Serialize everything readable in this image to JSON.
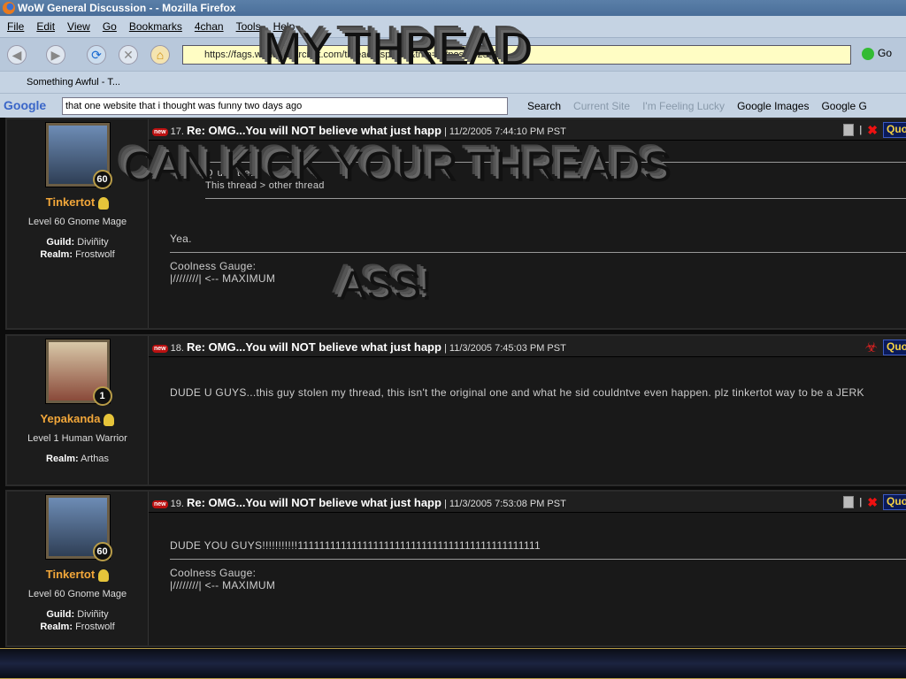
{
  "window": {
    "title": "WoW General Discussion - - Mozilla Firefox"
  },
  "menu": [
    "File",
    "Edit",
    "View",
    "Go",
    "Bookmarks",
    "4chan",
    "Tools",
    "Help"
  ],
  "nav": {
    "url": "https://fags.worldofwarcraft.com/thread.aspx?...&tmp=1#post5625496",
    "go": "Go"
  },
  "bookmarks": {
    "item": "Something Awful - T..."
  },
  "google": {
    "logo": "Google",
    "query": "that one website that i thought was funny two days ago",
    "items": [
      "Search",
      "Current Site",
      "I'm Feeling Lucky",
      "Google Images",
      "Google G"
    ]
  },
  "overlay": {
    "line1": "MY THREAD",
    "line2": "CAN KICK YOUR THREADS",
    "line3": "ASS!"
  },
  "posts": [
    {
      "num": "17.",
      "title": "Re: OMG...You will NOT believe what just happ",
      "date": "| 11/2/2005 7:44:10 PM PST",
      "name": "Tinkertot",
      "level": "60",
      "class": "Level 60 Gnome Mage",
      "guild_label": "Guild:",
      "guild": "Diviñity",
      "realm_label": "Realm:",
      "realm": "Frostwolf",
      "quote_label": "Q u o t e:",
      "quote": "This thread > other thread",
      "text": "Yea.",
      "sig1": "Coolness Gauge:",
      "sig2": "|////////| <-- MAXIMUM",
      "quote_btn": "Quote"
    },
    {
      "num": "18.",
      "title": "Re: OMG...You will NOT believe what just happ",
      "date": "| 11/3/2005 7:45:03 PM PST",
      "name": "Yepakanda",
      "level": "1",
      "class": "Level 1 Human Warrior",
      "realm_label": "Realm:",
      "realm": "Arthas",
      "text": "DUDE U GUYS...this guy stolen my thread, this isn't the original one and what he sid couldntve even happen. plz tinkertot way to be a JERK",
      "quote_btn": "Quote"
    },
    {
      "num": "19.",
      "title": "Re: OMG...You will NOT believe what just happ",
      "date": "| 11/3/2005 7:53:08 PM PST",
      "name": "Tinkertot",
      "level": "60",
      "class": "Level 60 Gnome Mage",
      "guild_label": "Guild:",
      "guild": "Diviñity",
      "realm_label": "Realm:",
      "realm": "Frostwolf",
      "text": "DUDE YOU GUYS!!!!!!!!!!!111111111111111111111111111111111111111111111",
      "sig1": "Coolness Gauge:",
      "sig2": "|////////| <-- MAXIMUM",
      "quote_btn": "Quote"
    }
  ],
  "new_badge": "new"
}
